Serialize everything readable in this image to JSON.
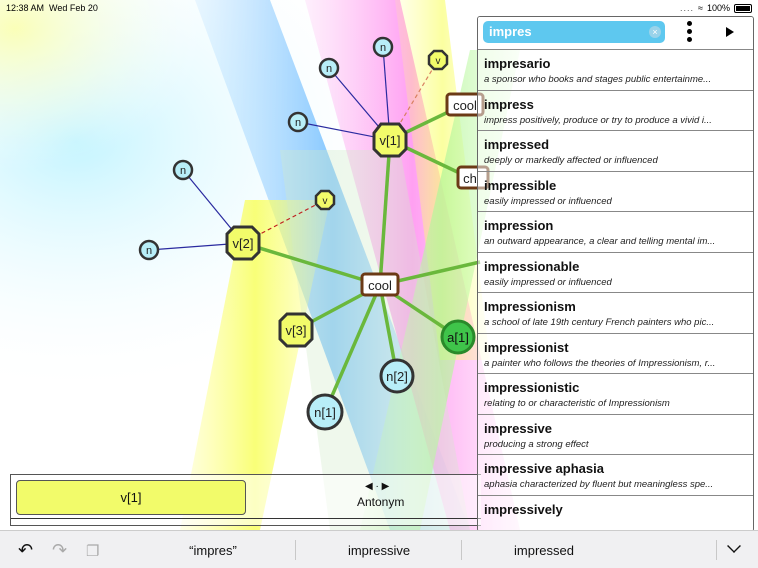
{
  "status_bar": {
    "time": "12:38 AM",
    "date": "Wed Feb 20",
    "battery": "100%"
  },
  "graph": {
    "nodes": [
      {
        "id": "cool-center",
        "label": "cool",
        "shape": "rect"
      },
      {
        "id": "v1",
        "label": "v[1]",
        "shape": "octagon"
      },
      {
        "id": "v2",
        "label": "v[2]",
        "shape": "octagon"
      },
      {
        "id": "v3",
        "label": "v[3]",
        "shape": "octagon"
      },
      {
        "id": "a1",
        "label": "a[1]",
        "shape": "circle-green"
      },
      {
        "id": "n1",
        "label": "n[1]",
        "shape": "circle"
      },
      {
        "id": "n2",
        "label": "n[2]",
        "shape": "circle"
      },
      {
        "id": "cool-top",
        "label": "cool",
        "shape": "rect"
      },
      {
        "id": "ch",
        "label": "ch",
        "shape": "rect"
      },
      {
        "id": "v-small-1",
        "label": "v",
        "shape": "octagon-small"
      },
      {
        "id": "v-small-2",
        "label": "v",
        "shape": "octagon-small"
      },
      {
        "id": "n-small-1",
        "label": "n",
        "shape": "circle-small"
      },
      {
        "id": "n-small-2",
        "label": "n",
        "shape": "circle-small"
      },
      {
        "id": "n-small-3",
        "label": "n",
        "shape": "circle-small"
      },
      {
        "id": "n-small-4",
        "label": "n",
        "shape": "circle-small"
      },
      {
        "id": "n-small-5",
        "label": "n",
        "shape": "circle-small"
      }
    ]
  },
  "search": {
    "query": "impres"
  },
  "results": [
    {
      "word": "impresario",
      "definition": "a sponsor who books and stages public entertainme..."
    },
    {
      "word": "impress",
      "definition": "impress positively, produce or try to produce a vivid i..."
    },
    {
      "word": "impressed",
      "definition": "deeply or markedly affected or influenced"
    },
    {
      "word": "impressible",
      "definition": "easily impressed or influenced"
    },
    {
      "word": "impression",
      "definition": "an outward appearance, a clear and telling mental im..."
    },
    {
      "word": "impressionable",
      "definition": "easily impressed or influenced"
    },
    {
      "word": "Impressionism",
      "definition": "a school of late 19th century French painters who pic..."
    },
    {
      "word": "impressionist",
      "definition": "a painter who follows the theories of Impressionism, r..."
    },
    {
      "word": "impressionistic",
      "definition": "relating to or characteristic of Impressionism"
    },
    {
      "word": "impressive",
      "definition": "producing a strong effect"
    },
    {
      "word": "impressive aphasia",
      "definition": "aphasia characterized by fluent but meaningless spe..."
    },
    {
      "word": "impressively",
      "definition": ""
    }
  ],
  "lower_panel": {
    "sense_label": "v[1]",
    "relation_label": "Antonym",
    "arrows": "◀ · ▶"
  },
  "keyboard_toolbar": {
    "suggestions": [
      "“impres”",
      "impressive",
      "impressed"
    ]
  },
  "icons": {
    "undo": "undo-icon",
    "redo": "redo-icon",
    "paste": "paste-icon",
    "dismiss": "chevron-down-icon"
  }
}
